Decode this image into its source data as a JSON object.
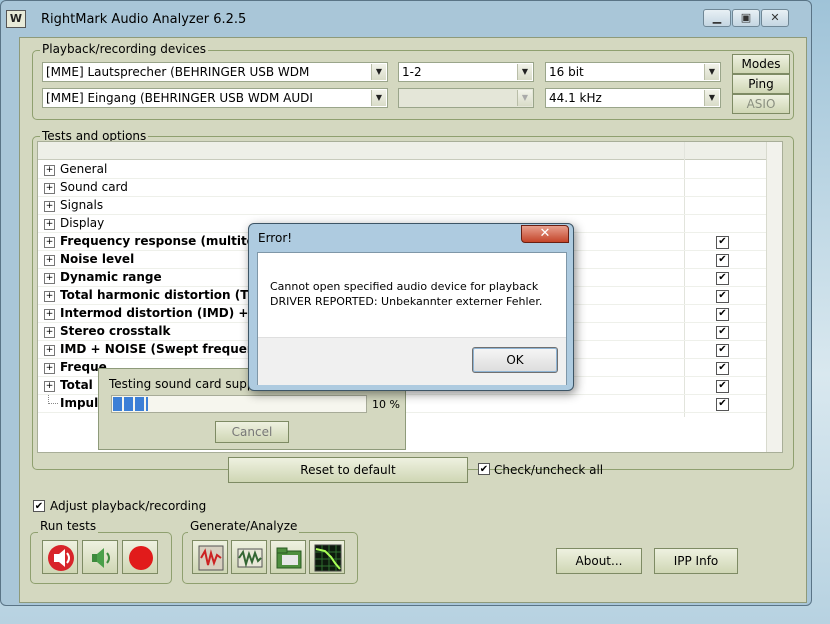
{
  "window": {
    "title": "RightMark Audio Analyzer 6.2.5",
    "icon_text": "W"
  },
  "devices": {
    "group_label": "Playback/recording devices",
    "playback_device": "[MME] Lautsprecher (BEHRINGER USB WDM",
    "playback_channels": "1-2",
    "bit_depth": "16 bit",
    "recording_device": "[MME] Eingang (BEHRINGER USB WDM AUDI",
    "recording_channels": "",
    "sample_rate": "44.1 kHz",
    "modes_label": "Modes",
    "ping_label": "Ping",
    "asio_label": "ASIO"
  },
  "tests": {
    "group_label": "Tests and options",
    "items": [
      {
        "label": "General",
        "bold": false,
        "expandable": true,
        "checked": null
      },
      {
        "label": "Sound card",
        "bold": false,
        "expandable": true,
        "checked": null
      },
      {
        "label": "Signals",
        "bold": false,
        "expandable": true,
        "checked": null
      },
      {
        "label": "Display",
        "bold": false,
        "expandable": true,
        "checked": null
      },
      {
        "label": "Frequency response (multitone",
        "bold": true,
        "expandable": true,
        "checked": true
      },
      {
        "label": "Noise level",
        "bold": true,
        "expandable": true,
        "checked": true
      },
      {
        "label": "Dynamic range",
        "bold": true,
        "expandable": true,
        "checked": true
      },
      {
        "label": "Total harmonic distortion (THD",
        "bold": true,
        "expandable": true,
        "checked": true
      },
      {
        "label": "Intermod distortion (IMD) + No",
        "bold": true,
        "expandable": true,
        "checked": true
      },
      {
        "label": "Stereo crosstalk",
        "bold": true,
        "expandable": true,
        "checked": true
      },
      {
        "label": "IMD + NOISE (Swept frequency",
        "bold": true,
        "expandable": true,
        "checked": true
      },
      {
        "label": "Freque",
        "bold": true,
        "expandable": true,
        "checked": true
      },
      {
        "label": "Total I",
        "bold": true,
        "expandable": true,
        "checked": true
      },
      {
        "label": "Impuls",
        "bold": true,
        "expandable": false,
        "checked": true
      }
    ],
    "reset_label": "Reset to default",
    "check_all_label": "Check/uncheck all"
  },
  "adjust_label": "Adjust playback/recording",
  "run_tests_label": "Run tests",
  "generate_label": "Generate/Analyze",
  "about_label": "About...",
  "ipp_label": "IPP Info",
  "progress": {
    "text": "Testing sound card support of",
    "percent_label": "10 %",
    "fraction": 0.1,
    "cancel_label": "Cancel"
  },
  "error_dialog": {
    "title": "Error!",
    "close_glyph": "✕",
    "line1": "Cannot open specified audio device for playback",
    "line2": "DRIVER REPORTED: Unbekannter externer Fehler.",
    "ok_label": "OK"
  },
  "colors": {
    "accent_green": "#8fa06f",
    "window_frame": "#a9c6d8",
    "record_red": "#e11b1b"
  }
}
